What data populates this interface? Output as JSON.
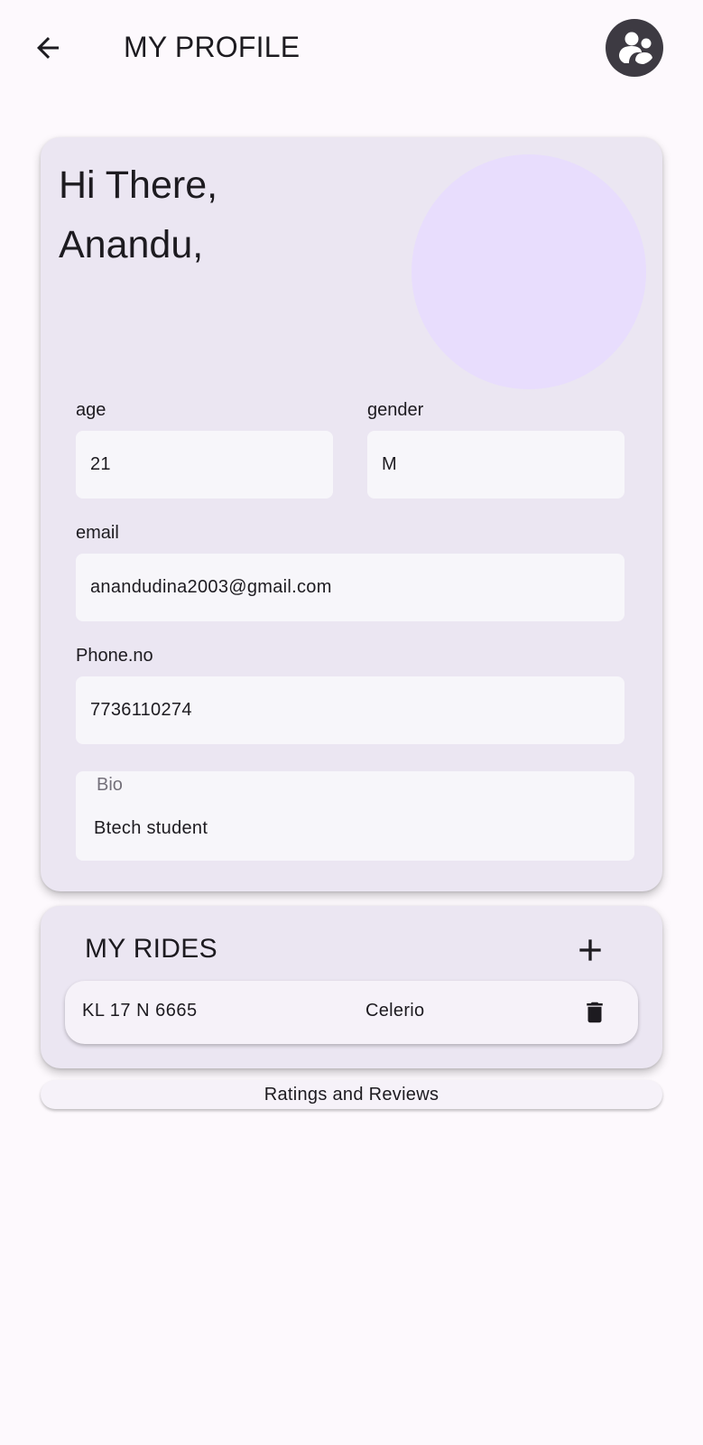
{
  "header": {
    "title": "MY PROFILE",
    "back_icon": "arrow-left-icon",
    "profile_icon": "group-avatar-icon"
  },
  "profile": {
    "greeting_line1": "Hi There,",
    "greeting_line2": "Anandu,",
    "age_label": "age",
    "age_value": "21",
    "gender_label": "gender",
    "gender_value": "M",
    "email_label": "email",
    "email_value": "anandudina2003@gmail.com",
    "phone_label": "Phone.no",
    "phone_value": "7736110274",
    "bio_label": "Bio",
    "bio_value": "Btech student"
  },
  "rides": {
    "title": "MY RIDES",
    "add_icon": "plus-icon",
    "items": [
      {
        "plate": "KL 17 N 6665",
        "model": "Celerio",
        "delete_icon": "trash-icon"
      }
    ]
  },
  "ratings": {
    "label": "Ratings and Reviews"
  },
  "colors": {
    "background": "#fdf9fd",
    "card": "#ebe6f2",
    "field": "#f7f6fa",
    "photo_placeholder": "#e8ddfd",
    "text": "#1d1b20",
    "avatar": "#3d3a42"
  }
}
